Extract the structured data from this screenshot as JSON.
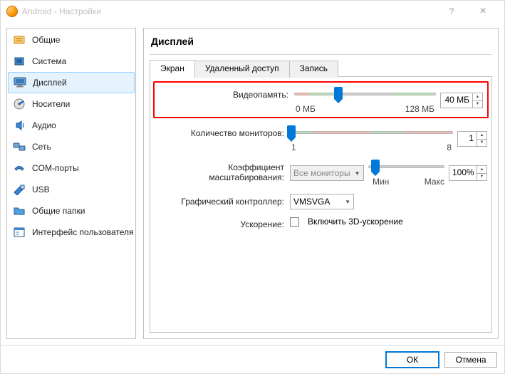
{
  "window": {
    "title": "Android - Настройки",
    "help": "?",
    "close": "×"
  },
  "sidebar": {
    "items": [
      {
        "label": "Общие"
      },
      {
        "label": "Система"
      },
      {
        "label": "Дисплей"
      },
      {
        "label": "Носители"
      },
      {
        "label": "Аудио"
      },
      {
        "label": "Сеть"
      },
      {
        "label": "COM-порты"
      },
      {
        "label": "USB"
      },
      {
        "label": "Общие папки"
      },
      {
        "label": "Интерфейс пользователя"
      }
    ]
  },
  "main": {
    "title": "Дисплей",
    "tabs": [
      "Экран",
      "Удаленный доступ",
      "Запись"
    ],
    "video": {
      "label": "Видеопамять:",
      "value": "40 МБ",
      "min_label": "0 МБ",
      "max_label": "128 МБ"
    },
    "monitors": {
      "label": "Количество мониторов:",
      "value": "1",
      "min_label": "1",
      "max_label": "8"
    },
    "scale": {
      "label": "Коэффициент масштабирования:",
      "combo": "Все мониторы",
      "value": "100%",
      "min_label": "Мин",
      "max_label": "Макс"
    },
    "controller": {
      "label": "Графический контроллер:",
      "value": "VMSVGA"
    },
    "accel": {
      "label": "Ускорение:",
      "checkbox_label": "Включить 3D-ускорение"
    }
  },
  "footer": {
    "ok": "ОК",
    "cancel": "Отмена"
  },
  "chart_data": {
    "type": "table",
    "rows": [
      {
        "setting": "Видеопамять",
        "value": 40,
        "unit": "МБ",
        "min": 0,
        "max": 128
      },
      {
        "setting": "Количество мониторов",
        "value": 1,
        "min": 1,
        "max": 8
      },
      {
        "setting": "Коэффициент масштабирования",
        "value": 100,
        "unit": "%"
      },
      {
        "setting": "Графический контроллер",
        "value": "VMSVGA"
      },
      {
        "setting": "Включить 3D-ускорение",
        "value": false
      }
    ]
  }
}
